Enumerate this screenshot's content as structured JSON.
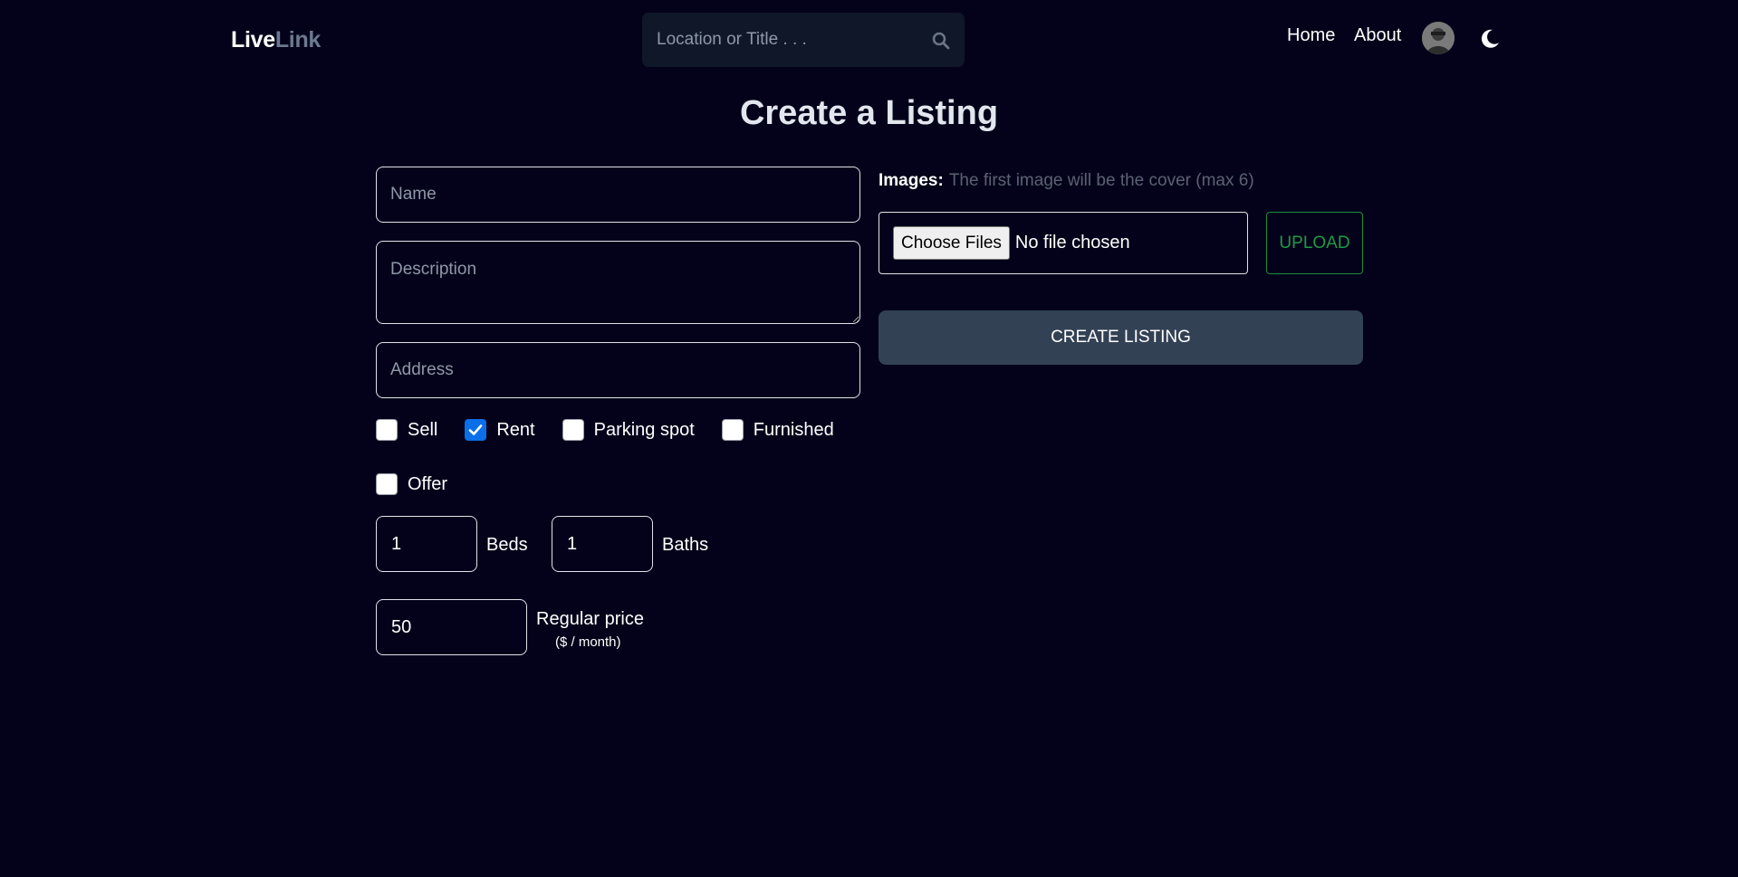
{
  "header": {
    "logo_part1": "Live",
    "logo_part2": "Link",
    "search_placeholder": "Location or Title . . .",
    "search_icon": "search-icon",
    "nav": {
      "home": "Home",
      "about": "About"
    },
    "theme_icon": "moon-icon"
  },
  "page": {
    "title": "Create a Listing"
  },
  "form": {
    "name_placeholder": "Name",
    "description_placeholder": "Description",
    "address_placeholder": "Address",
    "checkboxes": [
      {
        "label": "Sell",
        "checked": false
      },
      {
        "label": "Rent",
        "checked": true
      },
      {
        "label": "Parking spot",
        "checked": false
      },
      {
        "label": "Furnished",
        "checked": false
      },
      {
        "label": "Offer",
        "checked": false
      }
    ],
    "beds": {
      "value": "1",
      "label": "Beds"
    },
    "baths": {
      "value": "1",
      "label": "Baths"
    },
    "regular_price": {
      "value": "50",
      "label": "Regular price",
      "unit": "($ / month)"
    }
  },
  "images": {
    "label": "Images:",
    "hint": "The first image will be the cover (max 6)",
    "choose_files": "Choose Files",
    "no_file": "No file chosen",
    "upload": "UPLOAD"
  },
  "actions": {
    "create_listing": "CREATE LISTING"
  },
  "colors": {
    "background": "#04021a",
    "search_bg": "#0f1729",
    "button_bg": "#334155",
    "upload_green": "#1f9a45",
    "checkbox_blue": "#0a6fe8"
  }
}
